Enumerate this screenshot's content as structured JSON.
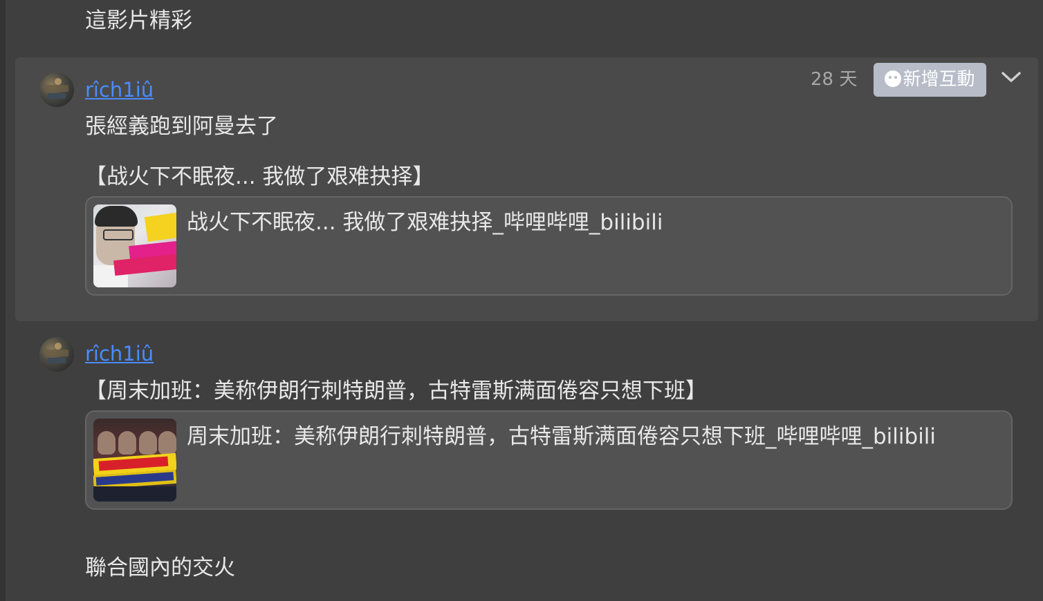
{
  "messages": {
    "top_text": "這影片精彩",
    "highlighted": {
      "username": "rîch1iû",
      "timestamp": "28 天",
      "react_button_label": "新增互動",
      "text": "張經義跑到阿曼去了",
      "share_title": "【战火下不眠夜... 我做了艰难抉择】",
      "embed": {
        "title": "战火下不眠夜... 我做了艰难抉择_哔哩哔哩_bilibili"
      }
    },
    "second": {
      "username": "rîch1iû",
      "share_title": "【周末加班：美称伊朗行刺特朗普，古特雷斯满面倦容只想下班】",
      "embed": {
        "title": "周末加班：美称伊朗行刺特朗普，古特雷斯满面倦容只想下班_哔哩哔哩_bilibili"
      }
    },
    "bottom_text": "聯合國內的交火"
  },
  "colors": {
    "background": "#3f3f3f",
    "highlight_card": "#4a4a4a",
    "username_link": "#4a8cff",
    "react_button": "#b7bcc8",
    "embed_background": "#525252"
  },
  "icons": {
    "react_button_icon": "smiley-add-icon",
    "menu_toggle": "chevron-down-icon"
  }
}
